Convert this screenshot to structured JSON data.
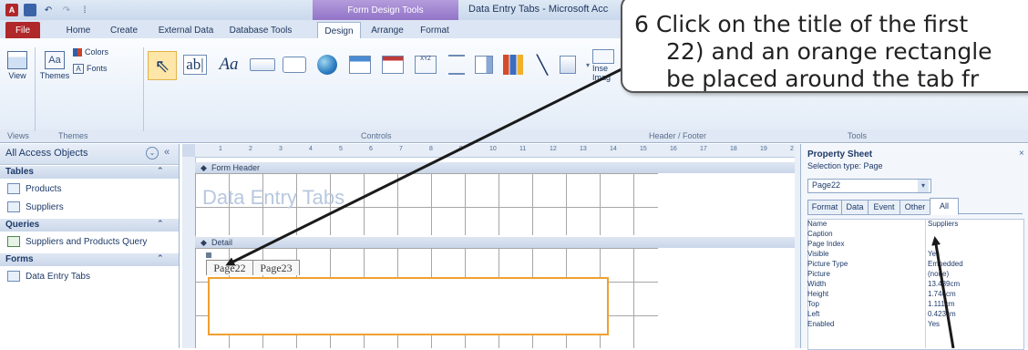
{
  "window": {
    "title": "Data Entry Tabs - Microsoft Acc",
    "context_tab_group": "Form Design Tools"
  },
  "ribbon_tabs": [
    "File",
    "Home",
    "Create",
    "External Data",
    "Database Tools",
    "Design",
    "Arrange",
    "Format"
  ],
  "ribbon": {
    "view_label": "View",
    "themes_label": "Themes",
    "colors_label": "Colors",
    "fonts_label": "Fonts",
    "groups": {
      "views": "Views",
      "themes": "Themes",
      "controls": "Controls",
      "header_footer": "Header / Footer",
      "tools": "Tools"
    },
    "textbox_glyph": "ab|",
    "label_glyph": "Aa",
    "insert_label": "Inse",
    "image_label": "Imag"
  },
  "nav": {
    "title": "All Access Objects",
    "sections": [
      {
        "name": "Tables",
        "items": [
          "Products",
          "Suppliers"
        ]
      },
      {
        "name": "Queries",
        "items": [
          "Suppliers and Products Query"
        ]
      },
      {
        "name": "Forms",
        "items": [
          "Data Entry Tabs"
        ]
      }
    ]
  },
  "form": {
    "header_section": "Form Header",
    "title": "Data Entry Tabs",
    "detail_section": "Detail",
    "tabs": [
      "Page22",
      "Page23"
    ],
    "ruler_numbers": [
      "1",
      "2",
      "3",
      "4",
      "5",
      "6",
      "7",
      "8",
      "9",
      "10",
      "11",
      "12",
      "13",
      "14",
      "15",
      "16",
      "17",
      "18",
      "19",
      "2"
    ]
  },
  "property_sheet": {
    "title": "Property Sheet",
    "selection_type": "Selection type:  Page",
    "selected_object": "Page22",
    "tabs": [
      "Format",
      "Data",
      "Event",
      "Other",
      "All"
    ],
    "active_tab": "All",
    "rows": [
      {
        "name": "Name",
        "value": "Suppliers"
      },
      {
        "name": "Caption",
        "value": ""
      },
      {
        "name": "Page Index",
        "value": ""
      },
      {
        "name": "Visible",
        "value": "Yes"
      },
      {
        "name": "Picture Type",
        "value": "Embedded"
      },
      {
        "name": "Picture",
        "value": "(none)"
      },
      {
        "name": "Width",
        "value": "13.439cm"
      },
      {
        "name": "Height",
        "value": "1.746cm"
      },
      {
        "name": "Top",
        "value": "1.111cm"
      },
      {
        "name": "Left",
        "value": "0.423cm"
      },
      {
        "name": "Enabled",
        "value": "Yes"
      }
    ]
  },
  "callout": {
    "lines": [
      "6 Click on the title of the first",
      "22) and an orange rectangle",
      "be placed around the tab fr"
    ]
  },
  "colors": {
    "access_red": "#b0282a",
    "context_purple": "#9274c8",
    "selection_orange": "#f0a030",
    "arrow": "#1a1a1a"
  }
}
